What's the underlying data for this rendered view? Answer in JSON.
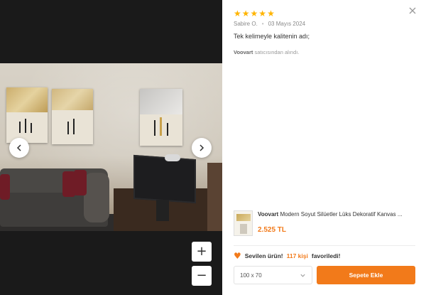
{
  "review": {
    "rating": 5,
    "stars": [
      "★",
      "★",
      "★",
      "★",
      "★"
    ],
    "author": "Sabire O.",
    "separator": "•",
    "date": "03 Mayıs 2024",
    "text": "Tek kelimeyle kalitenin adı;",
    "seller_name": "Voovart",
    "seller_suffix": " satıcısından alındı."
  },
  "gallery": {
    "image_description": "Living room with abstract silhouette canvas paintings on wall",
    "zoom_in_label": "+",
    "zoom_out_label": "−"
  },
  "product": {
    "brand": "Voovart",
    "title": "Modern Soyut Silüetler Lüks Dekoratif Kanvas ...",
    "price": "2.525 TL"
  },
  "favorite": {
    "prefix": "Sevilen ürün!",
    "count": "117 kişi",
    "suffix": "favoriledi!"
  },
  "purchase": {
    "selected_size": "100 x 70",
    "add_to_cart_label": "Sepete Ekle"
  },
  "colors": {
    "accent": "#f27a1a",
    "star": "#ffb400"
  }
}
